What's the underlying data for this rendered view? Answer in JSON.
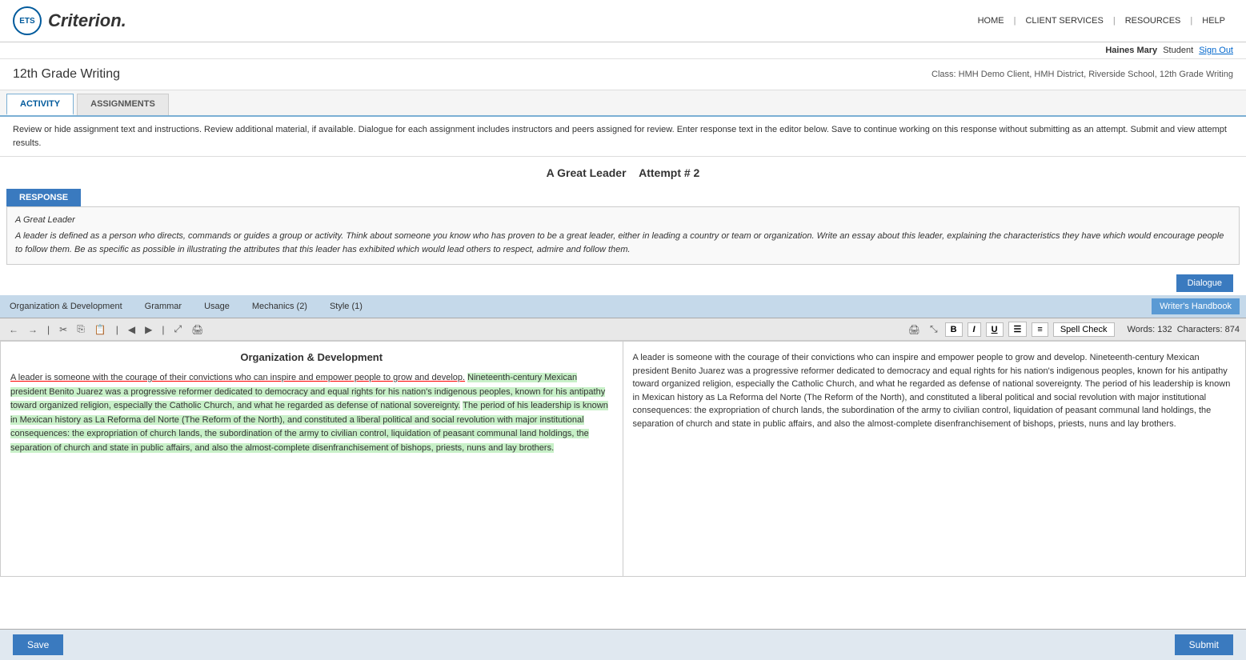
{
  "nav": {
    "logo_text": "ETS",
    "brand": "Criterion.",
    "links": [
      "HOME",
      "CLIENT SERVICES",
      "RESOURCES",
      "HELP"
    ]
  },
  "user": {
    "name": "Haines Mary",
    "role": "Student",
    "signout": "Sign Out"
  },
  "page": {
    "title": "12th Grade Writing",
    "class_info": "Class: HMH Demo Client, HMH District, Riverside School, 12th Grade Writing"
  },
  "tabs": {
    "tab1": "ACTIVITY",
    "tab2": "ASSIGNMENTS"
  },
  "instructions": "Review or hide assignment text and instructions. Review additional material, if available. Dialogue for each assignment includes instructors and peers assigned for review. Enter response text in the editor below. Save to continue working on this response without submitting as an attempt. Submit and view attempt results.",
  "assignment": {
    "title": "A Great Leader",
    "attempt_label": "Attempt #  2"
  },
  "response_tab": "RESPONSE",
  "prompt": {
    "title": "A Great Leader",
    "text": "A leader is defined as a person who directs, commands or guides a group or activity.  Think about someone you know who has proven to be a great leader, either in leading a country or team or organization. Write an essay about this leader, explaining the characteristics they have which would encourage people to follow them. Be as specific as possible in illustrating the attributes that this leader has exhibited which would lead others to respect, admire and follow them."
  },
  "dialogue_btn": "Dialogue",
  "scoring_tabs": [
    "Organization & Development",
    "Grammar",
    "Usage",
    "Mechanics (2)",
    "Style (1)"
  ],
  "writers_handbook": "Writer's Handbook",
  "toolbar": {
    "word_count": "Words: 132",
    "char_count": "Characters: 874",
    "spell_check": "Spell Check"
  },
  "left_pane": {
    "heading": "Organization & Development",
    "text_part1": "A leader is someone with the courage of their convictions who can inspire and empower people to grow and develop.",
    "text_part2": " Nineteenth-century Mexican president Benito Juarez was a  progressive reformer dedicated to democracy and equal rights for his nation's indigenous peoples, known for his antipathy toward organized religion, especially the Catholic Church, and what he regarded as defense of national sovereignty.",
    "text_part3": " The period of his leadership is known in Mexican history as La Reforma del Norte (The Reform of the North), and constituted a liberal political and social revolution with major institutional consequences: the expropriation of church lands, the subordination of the army to civilian control, liquidation of peasant communal land holdings, the separation of church and state in public affairs, and also the almost-complete disenfranchisement of bishops, priests, nuns and lay brothers."
  },
  "right_pane": {
    "text": "A leader is someone with the courage of their convictions who can inspire and empower people to grow and develop. Nineteenth-century Mexican president Benito Juarez was a  progressive reformer dedicated to democracy and equal rights for his nation's indigenous peoples, known for his antipathy toward organized religion, especially the Catholic Church, and what he regarded as defense of national sovereignty. The period of his leadership is known in Mexican history as La Reforma del Norte (The Reform of the North), and constituted a liberal political and social revolution with major institutional consequences: the expropriation of church lands, the subordination of the army to civilian control, liquidation of peasant communal land holdings, the separation of church and state in public affairs, and also the almost-complete disenfranchisement of bishops, priests, nuns and lay brothers."
  },
  "buttons": {
    "save": "Save",
    "submit": "Submit"
  }
}
